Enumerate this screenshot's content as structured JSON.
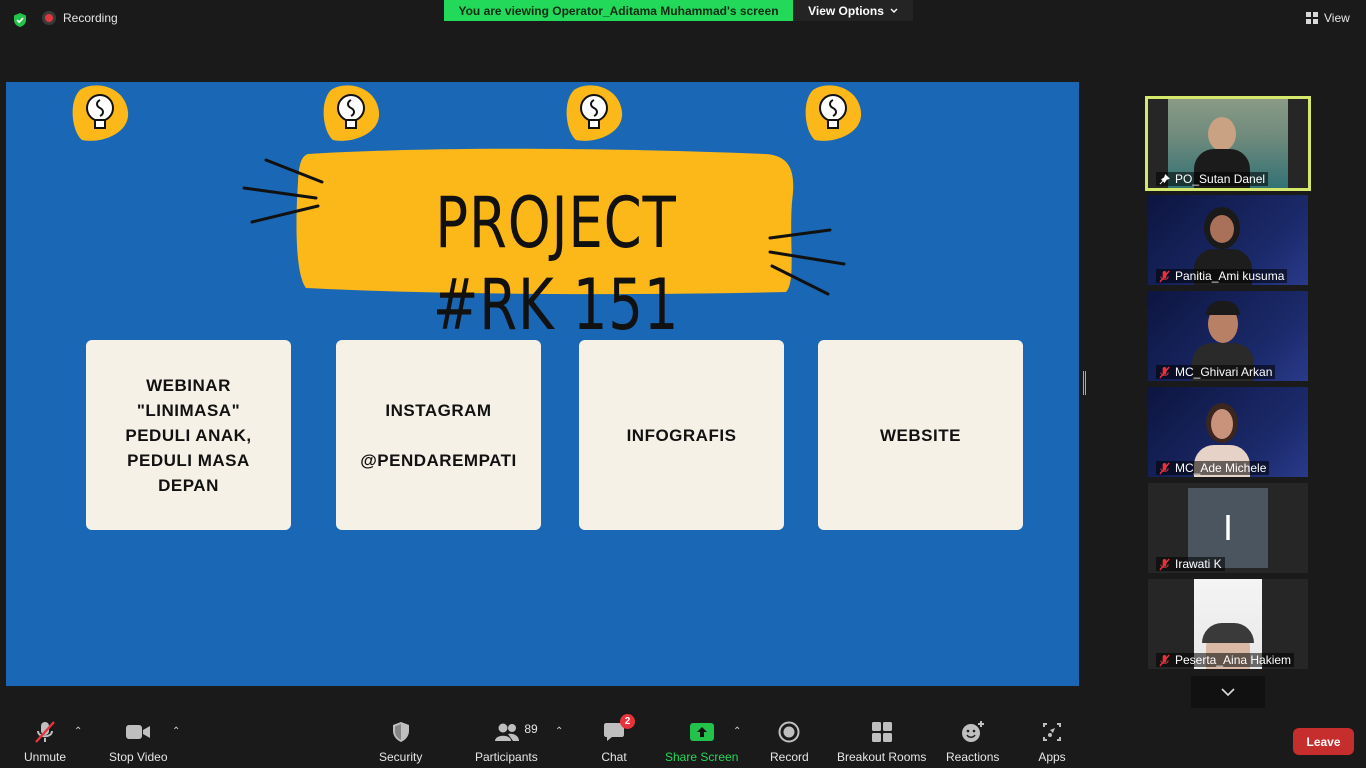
{
  "top_bar": {
    "recording_label": "Recording",
    "viewing_banner": "You are viewing Operator_Aditama Muhammad's screen",
    "view_options_label": "View Options",
    "view_label": "View"
  },
  "slide": {
    "title": "PROJECT #RK 151",
    "cards": [
      {
        "text": "WEBINAR\n\"LINIMASA\"\nPEDULI ANAK,\nPEDULI MASA\nDEPAN"
      },
      {
        "text": "INSTAGRAM\n\n@PENDAREMPATI"
      },
      {
        "text": "INFOGRAFIS"
      },
      {
        "text": "WEBSITE"
      }
    ],
    "background_color": "#1a68b5",
    "accent_color": "#fcb718"
  },
  "participants": [
    {
      "name": "PO_Sutan Danel",
      "icon": "pin-icon",
      "active": true
    },
    {
      "name": "Panitia_Ami kusuma",
      "icon": "mic-muted-icon"
    },
    {
      "name": "MC_Ghivari Arkan",
      "icon": "mic-muted-icon"
    },
    {
      "name": "MC_Ade Michele",
      "icon": "mic-muted-icon"
    },
    {
      "name": "Irawati K",
      "icon": "mic-muted-icon",
      "avatar_letter": "I"
    },
    {
      "name": "Peserta_Aina Hakiem",
      "icon": "mic-muted-icon"
    }
  ],
  "toolbar": {
    "unmute": "Unmute",
    "stop_video": "Stop Video",
    "security": "Security",
    "participants": "Participants",
    "participants_count": "89",
    "chat": "Chat",
    "chat_badge": "2",
    "share_screen": "Share Screen",
    "record": "Record",
    "breakout_rooms": "Breakout Rooms",
    "reactions": "Reactions",
    "apps": "Apps",
    "leave": "Leave"
  }
}
